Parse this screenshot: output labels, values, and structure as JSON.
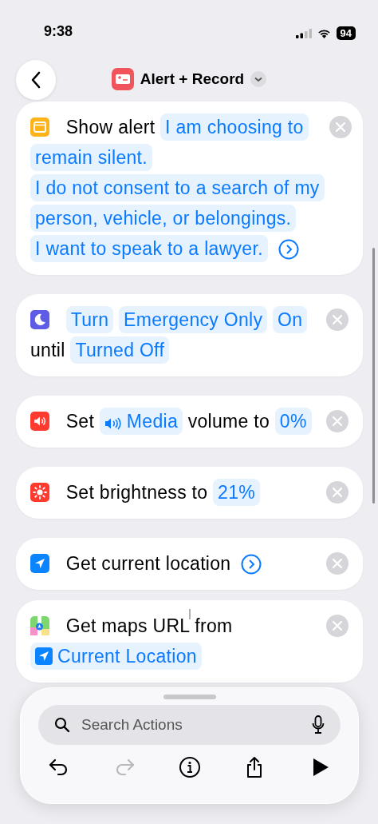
{
  "status_bar": {
    "time": "9:38",
    "battery": "94"
  },
  "header": {
    "title": "Alert + Record"
  },
  "actions": [
    {
      "kind": "alert",
      "linked": false,
      "parts": [
        {
          "kind": "label",
          "text": "Show alert"
        },
        {
          "kind": "token",
          "text": "I am choosing to"
        },
        {
          "kind": "token",
          "text": "remain silent."
        },
        {
          "kind": "token",
          "text": "I do not consent to a search of my"
        },
        {
          "kind": "token",
          "text": "person, vehicle, or belongings."
        },
        {
          "kind": "token",
          "text": "I want to speak to a lawyer."
        },
        {
          "kind": "expand"
        }
      ]
    },
    {
      "kind": "focus",
      "linked": false,
      "parts": [
        {
          "kind": "token",
          "text": "Turn"
        },
        {
          "kind": "token",
          "text": "Emergency Only"
        },
        {
          "kind": "token",
          "text": "On"
        },
        {
          "kind": "label",
          "text": "until"
        },
        {
          "kind": "token",
          "text": "Turned Off"
        }
      ]
    },
    {
      "kind": "volume",
      "linked": false,
      "parts": [
        {
          "kind": "label",
          "text": "Set"
        },
        {
          "kind": "media",
          "text": "Media"
        },
        {
          "kind": "label",
          "text": "volume to"
        },
        {
          "kind": "token",
          "text": "0%"
        }
      ]
    },
    {
      "kind": "brightness",
      "linked": false,
      "parts": [
        {
          "kind": "label",
          "text": "Set brightness to"
        },
        {
          "kind": "token",
          "text": "21%"
        }
      ]
    },
    {
      "kind": "location",
      "linked": false,
      "parts": [
        {
          "kind": "label",
          "text": "Get current location"
        },
        {
          "kind": "expand"
        }
      ]
    },
    {
      "kind": "maps",
      "linked": true,
      "parts": [
        {
          "kind": "label",
          "text": "Get maps URL from"
        },
        {
          "kind": "place",
          "text": "Current Location"
        }
      ]
    }
  ],
  "sheet": {
    "search": {
      "placeholder": "Search Actions"
    },
    "toolbar": [
      {
        "kind": "undo",
        "disabled": false
      },
      {
        "kind": "redo",
        "disabled": true
      },
      {
        "kind": "info",
        "disabled": false
      },
      {
        "kind": "share",
        "disabled": false
      },
      {
        "kind": "play",
        "disabled": false
      }
    ]
  }
}
